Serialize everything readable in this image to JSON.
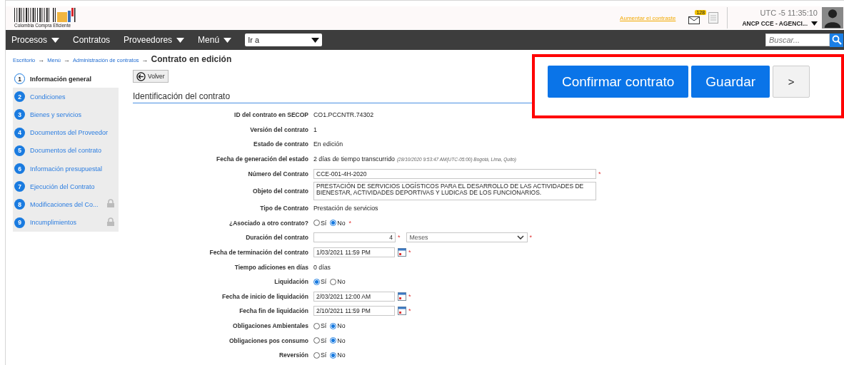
{
  "header": {
    "logo_text": "Colombia Compra Eficiente",
    "contrast_link": "Aumentar el contraste",
    "mail_badge": "128",
    "clock": "UTC -5 11:35:10",
    "account": "ANCP CCE - AGENCI..."
  },
  "nav": {
    "items": [
      {
        "label": "Procesos",
        "has_menu": true
      },
      {
        "label": "Contratos",
        "has_menu": false
      },
      {
        "label": "Proveedores",
        "has_menu": true
      },
      {
        "label": "Menú",
        "has_menu": true
      }
    ],
    "goto_value": "Ir a",
    "search_placeholder": "Buscar..."
  },
  "breadcrumb": {
    "separator": "→",
    "links": [
      "Escritorio",
      "Menú",
      "Administración de contratos"
    ],
    "current": "Contrato en edición"
  },
  "steps": [
    {
      "number": "1",
      "label": "Información general",
      "selected": true,
      "locked": false
    },
    {
      "number": "2",
      "label": "Condiciones",
      "selected": false,
      "locked": false
    },
    {
      "number": "3",
      "label": "Bienes y servicios",
      "selected": false,
      "locked": false
    },
    {
      "number": "4",
      "label": "Documentos del Proveedor",
      "selected": false,
      "locked": false
    },
    {
      "number": "5",
      "label": "Documentos del contrato",
      "selected": false,
      "locked": false
    },
    {
      "number": "6",
      "label": "Información presupuestal",
      "selected": false,
      "locked": false
    },
    {
      "number": "7",
      "label": "Ejecución del Contrato",
      "selected": false,
      "locked": false
    },
    {
      "number": "8",
      "label": "Modificaciones del Co...",
      "selected": false,
      "locked": true
    },
    {
      "number": "9",
      "label": "Incumplimientos",
      "selected": false,
      "locked": true
    }
  ],
  "back_button": "Volver",
  "actions": {
    "highlighted": true,
    "buttons": [
      {
        "label": "Confirmar contrato",
        "kind": "primary"
      },
      {
        "label": "Guardar",
        "kind": "primary"
      },
      {
        "label": ">",
        "kind": "secondary"
      }
    ]
  },
  "section_title": "Identificación del contrato",
  "fields": [
    {
      "kind": "text",
      "label": "ID del contrato en SECOP",
      "value": "CO1.PCCNTR.74302"
    },
    {
      "kind": "text",
      "label": "Versión del contrato",
      "value": "1"
    },
    {
      "kind": "text",
      "label": "Estado de contrato",
      "value": "En edición"
    },
    {
      "kind": "text",
      "label": "Fecha de generación del estado",
      "value": "2 días de tiempo transcurrido",
      "note": "(28/10/2020 9:53:47 AM(UTC-05:00) Bogotá, Lima, Quito)"
    },
    {
      "kind": "input",
      "label": "Número del Contrato",
      "value": "CCE-001-4H-2020",
      "required_mark": "*"
    },
    {
      "kind": "textarea",
      "label": "Objeto del contrato",
      "value": "PRESTACIÓN DE SERVICIOS LOGÍSTICOS PARA EL DESARROLLO DE LAS ACTIVIDADES DE BIENESTAR, ACTIVIDADES DEPORTIVAS Y LUDICAS DE LOS FUNCIONARIOS."
    },
    {
      "kind": "text",
      "label": "Tipo de Contrato",
      "value": "Prestación de servicios"
    },
    {
      "kind": "radio",
      "label": "¿Asociado a otro contrato?",
      "options": [
        {
          "label": "Sí",
          "selected": false
        },
        {
          "label": "No",
          "selected": true
        }
      ],
      "required_mark": "*"
    },
    {
      "kind": "duration",
      "label": "Duración del contrato",
      "value": "4",
      "unit": "Meses",
      "required_mark": "*"
    },
    {
      "kind": "date",
      "label": "Fecha de terminación del contrato",
      "value": "1/03/2021 11:59 PM",
      "required_mark": "*"
    },
    {
      "kind": "text",
      "label": "Tiempo adiciones en días",
      "value": "0 días"
    },
    {
      "kind": "radio",
      "label": "Liquidación",
      "options": [
        {
          "label": "Sí",
          "selected": true
        },
        {
          "label": "No",
          "selected": false
        }
      ]
    },
    {
      "kind": "date",
      "label": "Fecha de inicio de liquidación",
      "value": "2/03/2021 12:00 AM",
      "required_mark": "*"
    },
    {
      "kind": "date",
      "label": "Fecha fin de liquidación",
      "value": "2/10/2021 11:59 PM",
      "required_mark": "*"
    },
    {
      "kind": "radio",
      "label": "Obligaciones Ambientales",
      "options": [
        {
          "label": "Sí",
          "selected": false
        },
        {
          "label": "No",
          "selected": true
        }
      ]
    },
    {
      "kind": "radio",
      "label": "Obligaciones pos consumo",
      "options": [
        {
          "label": "Sí",
          "selected": false
        },
        {
          "label": "No",
          "selected": true
        }
      ]
    },
    {
      "kind": "radio",
      "label": "Reversión",
      "options": [
        {
          "label": "Sí",
          "selected": false
        },
        {
          "label": "No",
          "selected": true
        }
      ]
    }
  ]
}
